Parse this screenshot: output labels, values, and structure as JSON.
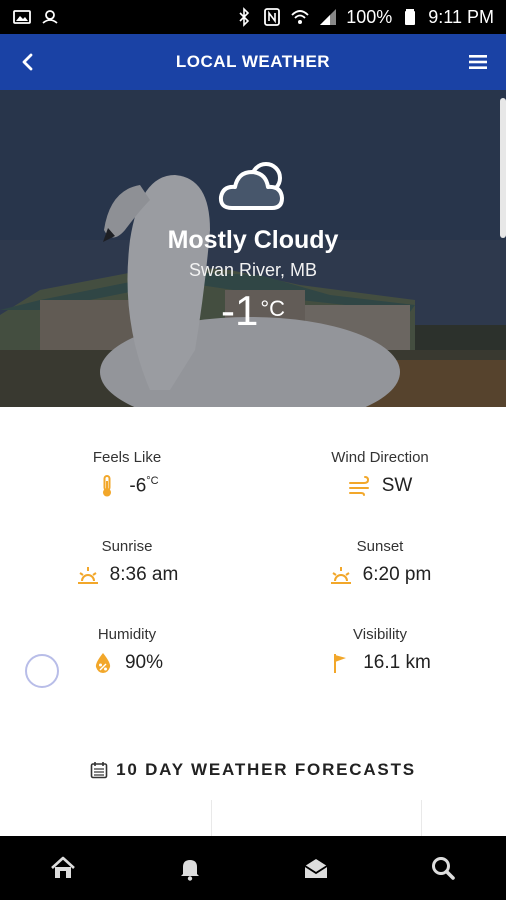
{
  "status_bar": {
    "battery": "100%",
    "time": "9:11 PM",
    "icons": [
      "image-icon",
      "cast-icon",
      "bluetooth-icon",
      "nfc-icon",
      "wifi-icon",
      "signal-icon",
      "battery-icon"
    ]
  },
  "header": {
    "title": "LOCAL WEATHER",
    "back_icon": "chevron-left-icon",
    "menu_icon": "hamburger-menu-icon"
  },
  "hero": {
    "condition": "Mostly Cloudy",
    "location": "Swan River, MB",
    "temperature": "-1",
    "temp_unit": "°C",
    "condition_icon": "cloud-icon"
  },
  "details": {
    "feels_like": {
      "label": "Feels Like",
      "value": "-6",
      "unit": "°C",
      "icon": "thermometer-icon"
    },
    "wind_direction": {
      "label": "Wind Direction",
      "value": "SW",
      "icon": "wind-icon"
    },
    "sunrise": {
      "label": "Sunrise",
      "value": "8:36 am",
      "icon": "sunrise-icon"
    },
    "sunset": {
      "label": "Sunset",
      "value": "6:20 pm",
      "icon": "sunset-icon"
    },
    "humidity": {
      "label": "Humidity",
      "value": "90%",
      "icon": "humidity-icon"
    },
    "visibility": {
      "label": "Visibility",
      "value": "16.1 km",
      "icon": "flag-icon"
    }
  },
  "forecast": {
    "title": "10 DAY WEATHER FORECASTS",
    "icon": "calendar-icon"
  },
  "bottom_nav": {
    "items": [
      "home-icon",
      "bell-icon",
      "mail-open-icon",
      "search-icon"
    ]
  },
  "colors": {
    "header_bg": "#1a42a5",
    "accent": "#f2a72a",
    "nav_bg": "#000000"
  }
}
